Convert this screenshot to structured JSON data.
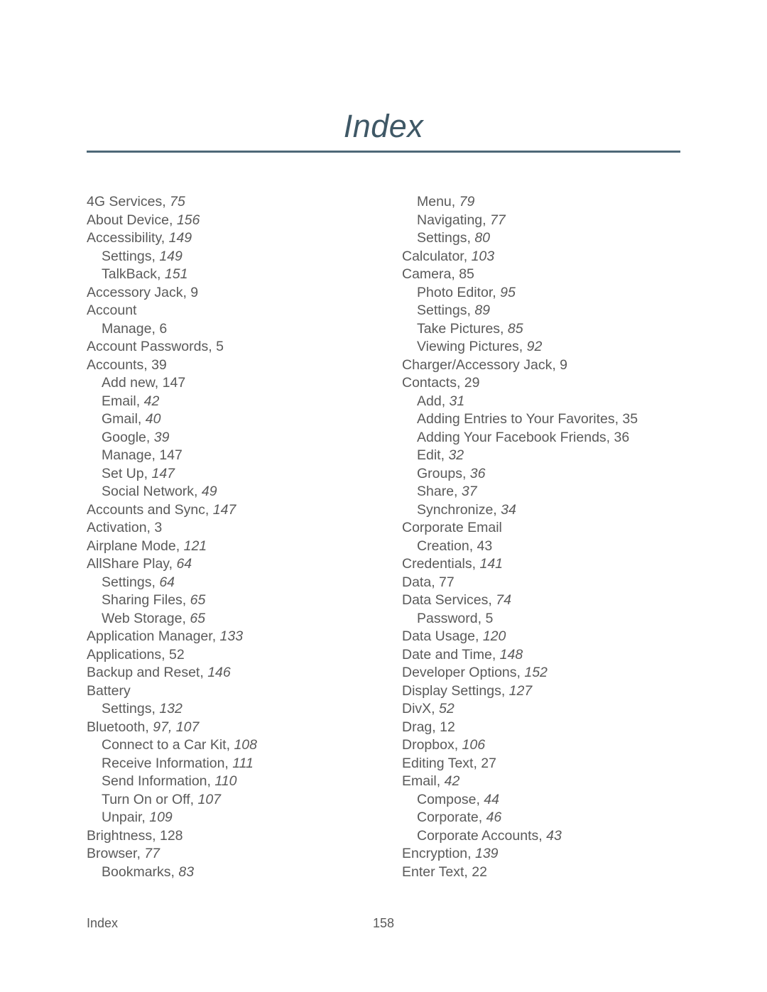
{
  "header": {
    "title": "Index",
    "rule_color": "#4e6878",
    "title_color": "#3f5866"
  },
  "footer": {
    "label": "Index",
    "page_number": "158"
  },
  "body": {
    "text_color": "#5a5a5a",
    "columns": [
      {
        "name": "left-column",
        "entries": [
          {
            "level": 1,
            "term": "4G Services,",
            "page": "75",
            "italic": true
          },
          {
            "level": 1,
            "term": "About Device,",
            "page": "156",
            "italic": true
          },
          {
            "level": 1,
            "term": "Accessibility,",
            "page": "149",
            "italic": true
          },
          {
            "level": 2,
            "term": "Settings,",
            "page": "149",
            "italic": true
          },
          {
            "level": 2,
            "term": "TalkBack,",
            "page": "151",
            "italic": true
          },
          {
            "level": 1,
            "term": "Accessory Jack,",
            "page": "9",
            "italic": false
          },
          {
            "level": 1,
            "term": "Account",
            "page": "",
            "italic": false
          },
          {
            "level": 2,
            "term": "Manage,",
            "page": "6",
            "italic": false
          },
          {
            "level": 1,
            "term": "Account Passwords,",
            "page": "5",
            "italic": false
          },
          {
            "level": 1,
            "term": "Accounts,",
            "page": "39",
            "italic": false
          },
          {
            "level": 2,
            "term": "Add new,",
            "page": "147",
            "italic": false
          },
          {
            "level": 2,
            "term": "Email,",
            "page": "42",
            "italic": true
          },
          {
            "level": 2,
            "term": "Gmail,",
            "page": "40",
            "italic": true
          },
          {
            "level": 2,
            "term": "Google,",
            "page": "39",
            "italic": true
          },
          {
            "level": 2,
            "term": "Manage,",
            "page": "147",
            "italic": false
          },
          {
            "level": 2,
            "term": "Set Up,",
            "page": "147",
            "italic": true
          },
          {
            "level": 2,
            "term": "Social Network,",
            "page": "49",
            "italic": true
          },
          {
            "level": 1,
            "term": "Accounts and Sync,",
            "page": "147",
            "italic": true
          },
          {
            "level": 1,
            "term": "Activation,",
            "page": "3",
            "italic": false
          },
          {
            "level": 1,
            "term": "Airplane Mode,",
            "page": "121",
            "italic": true
          },
          {
            "level": 1,
            "term": "AllShare Play,",
            "page": "64",
            "italic": true
          },
          {
            "level": 2,
            "term": "Settings,",
            "page": "64",
            "italic": true
          },
          {
            "level": 2,
            "term": "Sharing Files,",
            "page": "65",
            "italic": true
          },
          {
            "level": 2,
            "term": "Web Storage,",
            "page": "65",
            "italic": true
          },
          {
            "level": 1,
            "term": "Application Manager,",
            "page": "133",
            "italic": true
          },
          {
            "level": 1,
            "term": "Applications,",
            "page": "52",
            "italic": false
          },
          {
            "level": 1,
            "term": "Backup and Reset,",
            "page": "146",
            "italic": true
          },
          {
            "level": 1,
            "term": "Battery",
            "page": "",
            "italic": false
          },
          {
            "level": 2,
            "term": "Settings,",
            "page": "132",
            "italic": true
          },
          {
            "level": 1,
            "term": "Bluetooth,",
            "page": "97, 107",
            "italic": true
          },
          {
            "level": 2,
            "term": "Connect to a Car Kit,",
            "page": "108",
            "italic": true
          },
          {
            "level": 2,
            "term": "Receive Information,",
            "page": "111",
            "italic": true
          },
          {
            "level": 2,
            "term": "Send Information,",
            "page": "110",
            "italic": true
          },
          {
            "level": 2,
            "term": "Turn On or Off,",
            "page": "107",
            "italic": true
          },
          {
            "level": 2,
            "term": "Unpair,",
            "page": "109",
            "italic": true
          },
          {
            "level": 1,
            "term": "Brightness,",
            "page": "128",
            "italic": false
          },
          {
            "level": 1,
            "term": "Browser,",
            "page": "77",
            "italic": true
          },
          {
            "level": 2,
            "term": "Bookmarks,",
            "page": "83",
            "italic": true
          }
        ]
      },
      {
        "name": "right-column",
        "entries": [
          {
            "level": 2,
            "term": "Menu,",
            "page": "79",
            "italic": true
          },
          {
            "level": 2,
            "term": "Navigating,",
            "page": "77",
            "italic": true
          },
          {
            "level": 2,
            "term": "Settings,",
            "page": "80",
            "italic": true
          },
          {
            "level": 1,
            "term": "Calculator,",
            "page": "103",
            "italic": true
          },
          {
            "level": 1,
            "term": "Camera,",
            "page": "85",
            "italic": false
          },
          {
            "level": 2,
            "term": "Photo Editor,",
            "page": "95",
            "italic": true
          },
          {
            "level": 2,
            "term": "Settings,",
            "page": "89",
            "italic": true
          },
          {
            "level": 2,
            "term": "Take Pictures,",
            "page": "85",
            "italic": true
          },
          {
            "level": 2,
            "term": "Viewing Pictures,",
            "page": "92",
            "italic": true
          },
          {
            "level": 1,
            "term": "Charger/Accessory Jack,",
            "page": "9",
            "italic": false
          },
          {
            "level": 1,
            "term": "Contacts,",
            "page": "29",
            "italic": false
          },
          {
            "level": 2,
            "term": "Add,",
            "page": "31",
            "italic": true
          },
          {
            "level": 2,
            "term": "Adding Entries to Your Favorites,",
            "page": "35",
            "italic": false
          },
          {
            "level": 2,
            "term": "Adding Your Facebook Friends,",
            "page": "36",
            "italic": false
          },
          {
            "level": 2,
            "term": "Edit,",
            "page": "32",
            "italic": true
          },
          {
            "level": 2,
            "term": "Groups,",
            "page": "36",
            "italic": true
          },
          {
            "level": 2,
            "term": "Share,",
            "page": "37",
            "italic": true
          },
          {
            "level": 2,
            "term": "Synchronize,",
            "page": "34",
            "italic": true
          },
          {
            "level": 1,
            "term": "Corporate Email",
            "page": "",
            "italic": false
          },
          {
            "level": 2,
            "term": "Creation,",
            "page": "43",
            "italic": false
          },
          {
            "level": 1,
            "term": "Credentials,",
            "page": "141",
            "italic": true
          },
          {
            "level": 1,
            "term": "Data,",
            "page": "77",
            "italic": false
          },
          {
            "level": 1,
            "term": "Data Services,",
            "page": "74",
            "italic": true
          },
          {
            "level": 2,
            "term": "Password,",
            "page": "5",
            "italic": false
          },
          {
            "level": 1,
            "term": "Data Usage,",
            "page": "120",
            "italic": true
          },
          {
            "level": 1,
            "term": "Date and Time,",
            "page": "148",
            "italic": true
          },
          {
            "level": 1,
            "term": "Developer Options,",
            "page": "152",
            "italic": true
          },
          {
            "level": 1,
            "term": "Display Settings,",
            "page": "127",
            "italic": true
          },
          {
            "level": 1,
            "term": "DivX,",
            "page": "52",
            "italic": true
          },
          {
            "level": 1,
            "term": "Drag,",
            "page": "12",
            "italic": false
          },
          {
            "level": 1,
            "term": "Dropbox,",
            "page": "106",
            "italic": true
          },
          {
            "level": 1,
            "term": "Editing Text,",
            "page": "27",
            "italic": false
          },
          {
            "level": 1,
            "term": "Email,",
            "page": "42",
            "italic": true
          },
          {
            "level": 2,
            "term": "Compose,",
            "page": "44",
            "italic": true
          },
          {
            "level": 2,
            "term": "Corporate,",
            "page": "46",
            "italic": true
          },
          {
            "level": 2,
            "term": "Corporate Accounts,",
            "page": "43",
            "italic": true
          },
          {
            "level": 1,
            "term": "Encryption,",
            "page": "139",
            "italic": true
          },
          {
            "level": 1,
            "term": "Enter Text,",
            "page": "22",
            "italic": false
          }
        ]
      }
    ]
  }
}
